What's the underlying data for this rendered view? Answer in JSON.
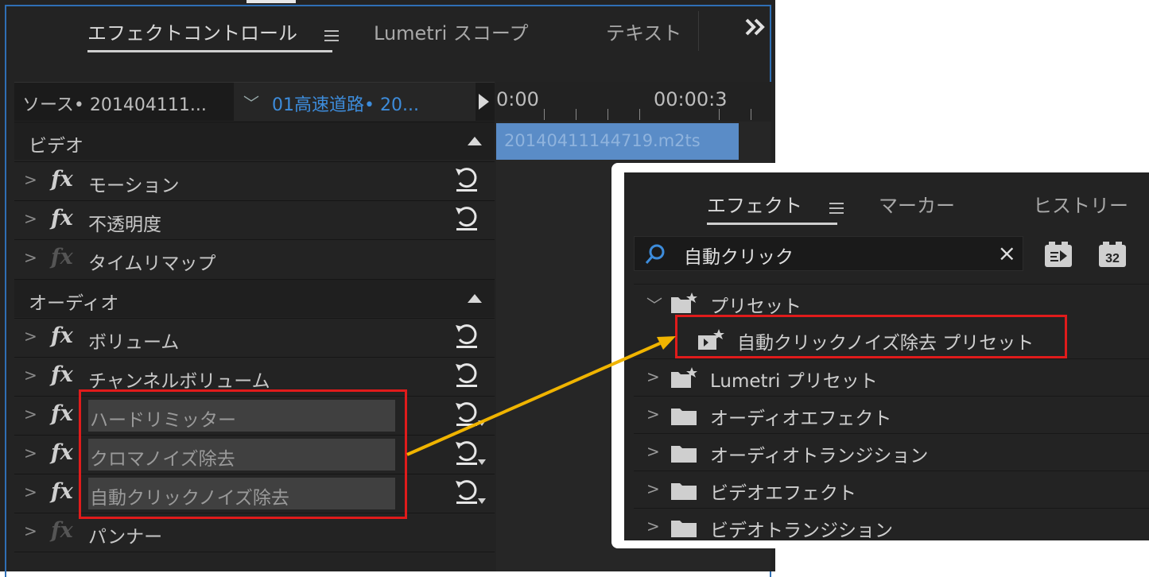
{
  "colors": {
    "accent_blue": "#2f6fb5",
    "clip_link": "#3d8cdb",
    "highlight_red": "#e01b1b",
    "arrow_yellow": "#f0b400",
    "clip_bar": "#5a8cc7"
  },
  "effect_controls": {
    "tabs": [
      "エフェクトコントロール",
      "Lumetri スコープ",
      "テキスト"
    ],
    "more_icon": "double-chevron-right-icon",
    "source_label": "ソース• 201404111...",
    "clip_selector": "01高速道路• 20...",
    "timecodes": [
      "0:00",
      "00:00:3"
    ],
    "clip_name": "20140411144719.m2ts",
    "video_header": "ビデオ",
    "audio_header": "オーディオ",
    "video_effects": [
      "モーション",
      "不透明度",
      "タイムリマップ"
    ],
    "audio_effects": [
      "ボリューム",
      "チャンネルボリューム",
      "ハードリミッター",
      "クロマノイズ除去",
      "自動クリックノイズ除去",
      "パンナー"
    ]
  },
  "effects_panel": {
    "tabs": [
      "エフェクト",
      "マーカー",
      "ヒストリー"
    ],
    "search_value": "自動クリック",
    "search_icon": "search-icon",
    "clear_icon": "×",
    "button_32": "32",
    "tree": [
      "プリセット",
      "自動クリックノイズ除去 プリセット",
      "Lumetri プリセット",
      "オーディオエフェクト",
      "オーディオトランジション",
      "ビデオエフェクト",
      "ビデオトランジション"
    ]
  }
}
